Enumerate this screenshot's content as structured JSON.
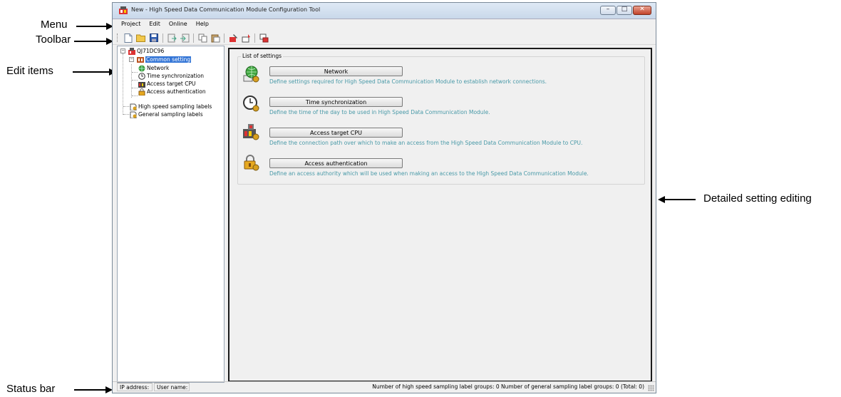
{
  "callouts": {
    "menu": "Menu",
    "toolbar": "Toolbar",
    "edit_items": "Edit items",
    "detailed": "Detailed setting editing",
    "status_bar": "Status bar"
  },
  "window": {
    "title": "New - High Speed Data Communication Module Configuration Tool",
    "controls": [
      "minimize",
      "maximize",
      "close"
    ]
  },
  "menu": [
    "Project",
    "Edit",
    "Online",
    "Help"
  ],
  "toolbar_icons": [
    "new-icon",
    "open-folder-icon",
    "save-icon",
    "export-icon",
    "import-icon",
    "copy-icon",
    "paste-icon",
    "write-icon",
    "read-icon",
    "connect-icon"
  ],
  "tree": {
    "root": "QJ71DC96",
    "common": "Common setting",
    "network": "Network",
    "time_sync": "Time synchronization",
    "access_cpu": "Access target CPU",
    "access_auth": "Access authentication",
    "high_speed": "High speed sampling labels",
    "general": "General sampling labels"
  },
  "list": {
    "legend": "List of settings",
    "items": [
      {
        "label": "Network",
        "desc": "Define settings required for High Speed Data Communication Module to establish network connections.",
        "icon": "network-globe-icon"
      },
      {
        "label": "Time synchronization",
        "desc": "Define the time of the day to be used in High Speed Data Communication Module.",
        "icon": "clock-icon"
      },
      {
        "label": "Access target CPU",
        "desc": "Define the connection path over which to make an access from the High Speed Data Communication Module to CPU.",
        "icon": "cpu-icon"
      },
      {
        "label": "Access authentication",
        "desc": "Define an access authority which will be used when making an access to the High Speed Data Communication Module.",
        "icon": "lock-icon"
      }
    ]
  },
  "status": {
    "ip": "IP address:",
    "user": "User name:",
    "summary": "Number of high speed sampling label groups: 0   Number of general sampling label groups: 0   (Total: 0)"
  },
  "colors": {
    "selection": "#3375d6",
    "description_text": "#4a9aa8",
    "close_button": "#c2432a"
  }
}
